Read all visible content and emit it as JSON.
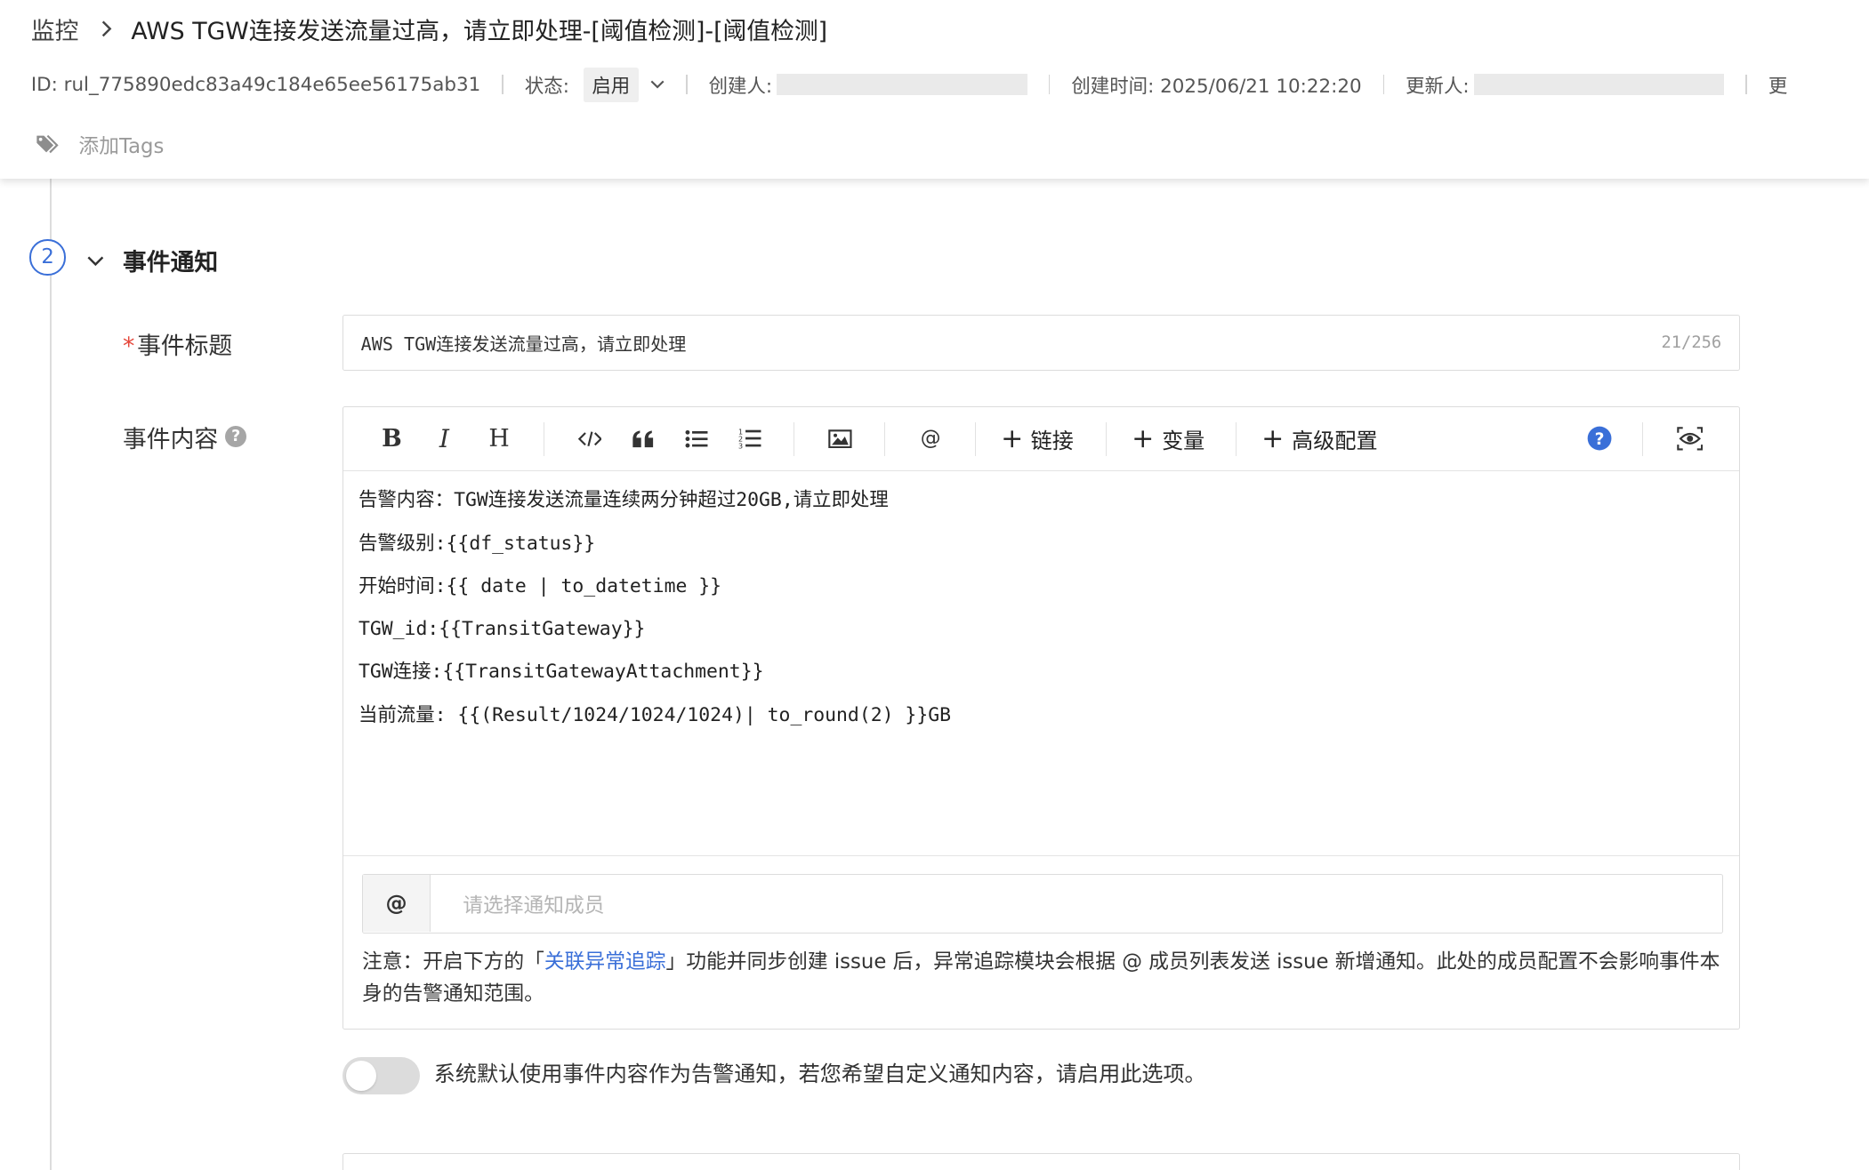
{
  "breadcrumb": {
    "root": "监控",
    "title": "AWS TGW连接发送流量过高，请立即处理-[阈值检测]-[阈值检测]"
  },
  "meta": {
    "id_text": "ID: rul_775890edc83a49c184e65ee56175ab31",
    "status_label": "状态:",
    "status_value": "启用",
    "creator_label": "创建人: ",
    "created_time_text": "创建时间: 2025/06/21 10:22:20",
    "updater_label": "更新人: ",
    "trailing_label": "更"
  },
  "tags": {
    "add_label": "添加Tags"
  },
  "section": {
    "step_number": "2",
    "title": "事件通知"
  },
  "event_title": {
    "required_mark": "*",
    "label": "事件标题",
    "value": "AWS TGW连接发送流量过高，请立即处理",
    "counter": "21/256"
  },
  "event_content": {
    "label": "事件内容",
    "toolbar": {
      "bold": "B",
      "italic": "I",
      "heading": "H",
      "mention": "@",
      "link_label": "链接",
      "variable_label": "变量",
      "advanced_label": "高级配置"
    },
    "lines": [
      "告警内容：TGW连接发送流量连续两分钟超过20GB,请立即处理",
      "告警级别:{{df_status}}",
      "开始时间:{{ date | to_datetime }}",
      "TGW_id:{{TransitGateway}}",
      "TGW连接:{{TransitGatewayAttachment}}",
      "当前流量: {{(Result/1024/1024/1024)| to_round(2) }}GB"
    ],
    "member_prefix": "@",
    "member_placeholder": "请选择通知成员",
    "notice_before": "注意：开启下方的「",
    "notice_link": "关联异常追踪",
    "notice_after": "」功能并同步创建 issue 后，异常追踪模块会根据 @ 成员列表发送 issue 新增通知。此处的成员配置不会影响事件本身的告警通知范围。"
  },
  "custom_notify": {
    "enabled": false,
    "label": "系统默认使用事件内容作为告警通知，若您希望自定义通知内容，请启用此选项。"
  },
  "colors": {
    "accent": "#3a6fd8",
    "required": "#e5483c",
    "toggle_off": "#dcdcdc"
  }
}
